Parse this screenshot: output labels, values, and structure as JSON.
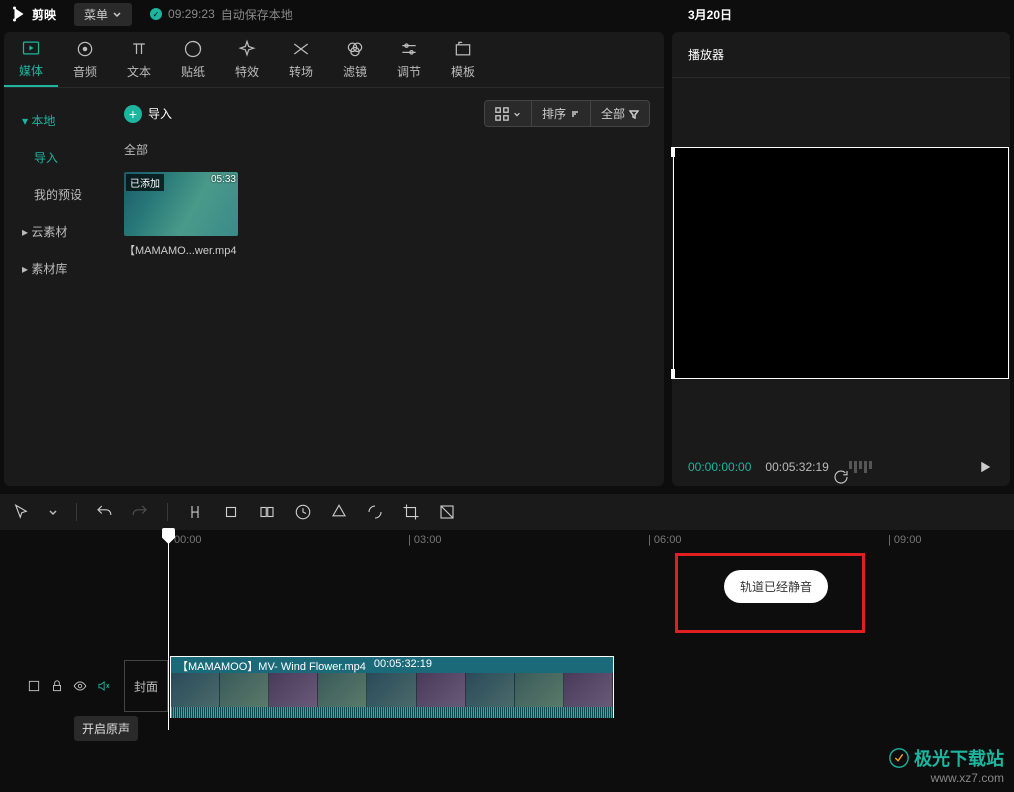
{
  "topbar": {
    "app_name": "剪映",
    "menu_label": "菜单",
    "autosave_time": "09:29:23",
    "autosave_text": "自动保存本地",
    "project_title": "3月20日"
  },
  "tool_tabs": [
    {
      "label": "媒体"
    },
    {
      "label": "音频"
    },
    {
      "label": "文本"
    },
    {
      "label": "贴纸"
    },
    {
      "label": "特效"
    },
    {
      "label": "转场"
    },
    {
      "label": "滤镜"
    },
    {
      "label": "调节"
    },
    {
      "label": "模板"
    }
  ],
  "sidebar": {
    "items": [
      {
        "label": "本地",
        "active": true,
        "expandable": true
      },
      {
        "label": "导入",
        "active": true,
        "sub": true
      },
      {
        "label": "我的预设",
        "sub": true
      },
      {
        "label": "云素材",
        "expandable": true
      },
      {
        "label": "素材库",
        "expandable": true
      }
    ]
  },
  "content": {
    "import_label": "导入",
    "sort_label": "排序",
    "all_filter_label": "全部",
    "all_label": "全部",
    "thumb": {
      "badge": "已添加",
      "duration": "05:33",
      "name": "【MAMAMO...wer.mp4"
    }
  },
  "player": {
    "title": "播放器",
    "current_time": "00:00:00:00",
    "total_time": "00:05:32:19"
  },
  "ruler": {
    "ticks": [
      {
        "label": "00:00",
        "pos": 0
      },
      {
        "label": "| 03:00",
        "pos": 240
      },
      {
        "label": "| 06:00",
        "pos": 480
      },
      {
        "label": "| 09:00",
        "pos": 720
      }
    ]
  },
  "track": {
    "cover_label": "封面",
    "tooltip": "开启原声"
  },
  "clip": {
    "name": "【MAMAMOO】MV- Wind Flower.mp4",
    "duration": "00:05:32:19"
  },
  "toast": "轨道已经静音",
  "watermark": {
    "line1": "极光下载站",
    "line2": "www.xz7.com"
  }
}
